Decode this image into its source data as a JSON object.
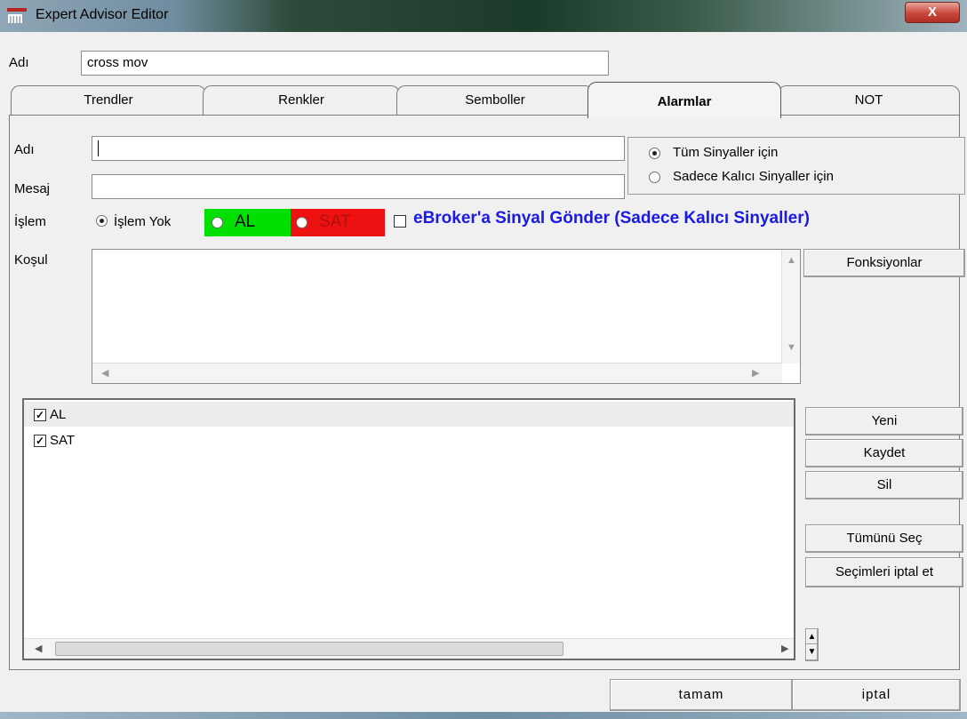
{
  "window": {
    "title": "Expert Advisor Editor",
    "close_label": "X"
  },
  "name_row": {
    "label": "Adı",
    "value": "cross mov"
  },
  "tabs": [
    {
      "label": "Trendler"
    },
    {
      "label": "Renkler"
    },
    {
      "label": "Semboller"
    },
    {
      "label": "Alarmlar",
      "active": true
    },
    {
      "label": "NOT"
    }
  ],
  "alarm": {
    "name_label": "Adı",
    "name_value": "",
    "message_label": "Mesaj",
    "message_value": "",
    "signal_scope": {
      "options": [
        "Tüm Sinyaller için",
        "Sadece Kalıcı Sinyaller için"
      ],
      "selected": "Tüm Sinyaller için"
    },
    "action_label": "İşlem",
    "action_options": {
      "none": "İşlem Yok",
      "buy": "AL",
      "sell": "SAT"
    },
    "action_selected": "İşlem Yok",
    "ebroker_label": "eBroker'a Sinyal Gönder (Sadece Kalıcı Sinyaller)",
    "ebroker_checked": false,
    "condition_label": "Koşul",
    "condition_value": "",
    "functions_button": "Fonksiyonlar"
  },
  "alarm_list": {
    "items": [
      {
        "label": "AL",
        "checked": true
      },
      {
        "label": "SAT",
        "checked": true
      }
    ]
  },
  "side_buttons": {
    "new": "Yeni",
    "save": "Kaydet",
    "delete": "Sil",
    "select_all": "Tümünü Seç",
    "deselect": "Seçimleri iptal et"
  },
  "footer": {
    "ok": "tamam",
    "cancel": "iptal"
  },
  "colors": {
    "buy_bg": "#00e000",
    "sell_bg": "#ee1111",
    "ebroker_text": "#1a1ae6",
    "sell_text": "#b01010"
  }
}
